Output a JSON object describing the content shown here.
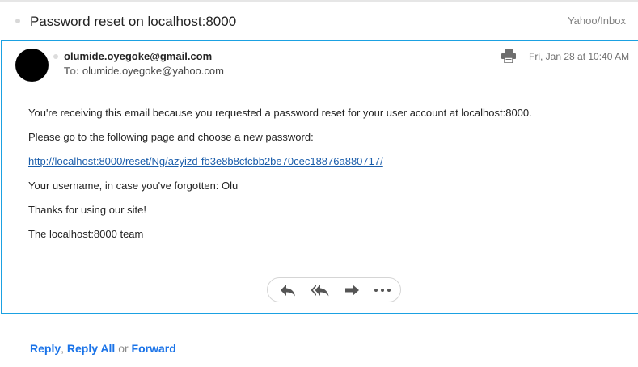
{
  "header": {
    "subject": "Password reset on localhost:8000",
    "folder": "Yahoo/Inbox"
  },
  "message": {
    "sender": "olumide.oyegoke@gmail.com",
    "to_label": "To:",
    "to_address": "olumide.oyegoke@yahoo.com",
    "date": "Fri, Jan 28 at 10:40 AM",
    "menu_glyph": "⋮",
    "body": {
      "line1": "You're receiving this email because you requested a password reset for your user account at localhost:8000.",
      "line2": "Please go to the following page and choose a new password:",
      "link": "http://localhost:8000/reset/Ng/azyizd-fb3e8b8cfcbb2be70cec18876a880717/",
      "line3": "Your username, in case you've forgotten: Olu",
      "line4": "Thanks for using our site!",
      "line5": "The localhost:8000 team"
    },
    "actions": [
      "reply-icon",
      "reply-all-icon",
      "forward-icon",
      "more-icon"
    ]
  },
  "footer": {
    "reply": "Reply",
    "comma": ",",
    "reply_all": "Reply All",
    "or": "or",
    "forward": "Forward"
  },
  "colors": {
    "accent_border": "#1ba1e2",
    "link": "#1a73e8",
    "text": "#232323"
  }
}
